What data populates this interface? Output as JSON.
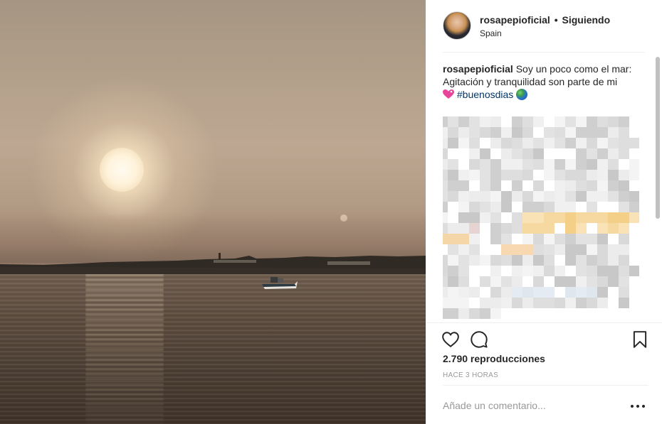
{
  "post": {
    "username": "rosapepioficial",
    "separator": "•",
    "follow_status": "Siguiendo",
    "location": "Spain"
  },
  "caption": {
    "username": "rosapepioficial",
    "line1": "Soy un poco como el mar:",
    "line2": "Agitación y tranquilidad son parte de mi",
    "hashtag": "#buenosdias"
  },
  "stats": {
    "views": "2.790 reproducciones",
    "time_ago": "HACE 3 HORAS"
  },
  "comment_form": {
    "placeholder": "Añade un comentario..."
  },
  "icons": {
    "like": "heart-outline-icon",
    "comment": "speech-bubble-icon",
    "save": "bookmark-icon",
    "more": "more-options-icon"
  },
  "colors": {
    "hashtag": "#003569",
    "text": "#262626",
    "muted": "#999999",
    "divider": "#efefef"
  }
}
